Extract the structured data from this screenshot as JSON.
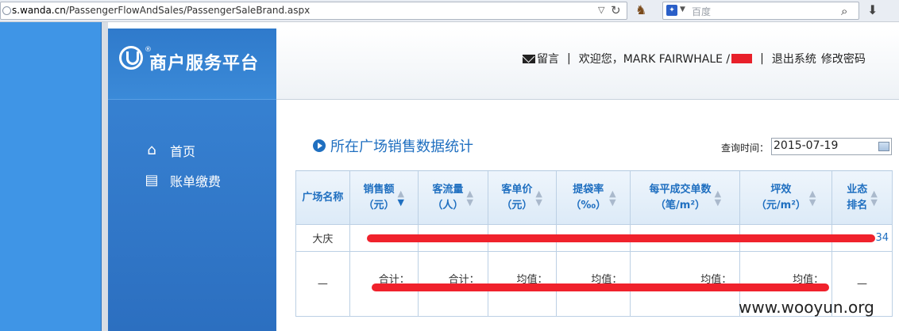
{
  "browser": {
    "url_host": "s.wanda.cn",
    "url_path": "/PassengerFlowAndSales/PassengerSaleBrand.aspx",
    "search_placeholder": "百度"
  },
  "sidebar": {
    "logo_reg": "®",
    "logo_text": "商户服务平台",
    "items": [
      {
        "label": "首页",
        "icon": "home-icon"
      },
      {
        "label": "账单缴费",
        "icon": "bill-icon"
      }
    ]
  },
  "header": {
    "message": "留言",
    "welcome": "欢迎您，MARK FAIRWHALE /",
    "logout": "退出系统",
    "change_password": "修改密码",
    "separator": "|"
  },
  "section": {
    "title": "所在广场销售数据统计",
    "query_label": "查询时间：",
    "query_date": "2015-07-19"
  },
  "table": {
    "columns": [
      {
        "line1": "广场名称",
        "line2": "",
        "sortable": false
      },
      {
        "line1": "销售额",
        "line2": "（元）",
        "sortable": true,
        "active": "down"
      },
      {
        "line1": "客流量",
        "line2": "（人）",
        "sortable": true
      },
      {
        "line1": "客单价",
        "line2": "（元）",
        "sortable": true
      },
      {
        "line1": "提袋率",
        "line2": "（‰）",
        "sortable": true
      },
      {
        "line1": "每平成交单数",
        "line2": "（笔/m²）",
        "sortable": true
      },
      {
        "line1": "坪效",
        "line2": "（元/m²）",
        "sortable": true
      },
      {
        "line1": "业态",
        "line2": "排名",
        "sortable": true
      }
    ],
    "row": {
      "plaza": "大庆",
      "rank_tail": "34"
    },
    "summary": {
      "first": "—",
      "labels": [
        "合计：",
        "合计：",
        "均值：",
        "均值：",
        "均值：",
        "均值："
      ],
      "last": "—"
    }
  },
  "watermark": "www.wooyun.org",
  "colors": {
    "accent": "#1f6fc0",
    "redaction": "#f0222c",
    "sidebar": "#2f7acb"
  }
}
